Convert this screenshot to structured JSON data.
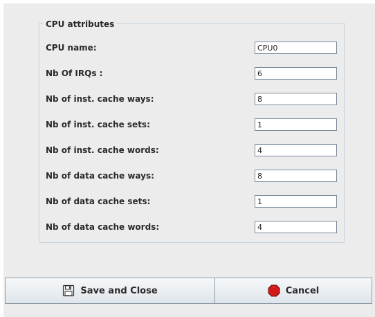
{
  "group": {
    "title": "CPU attributes"
  },
  "fields": [
    {
      "label": "CPU name:",
      "value": "CPU0"
    },
    {
      "label": "Nb Of IRQs :",
      "value": "6"
    },
    {
      "label": "Nb of inst. cache ways:",
      "value": "8"
    },
    {
      "label": "Nb of inst. cache sets:",
      "value": "1"
    },
    {
      "label": "Nb of inst. cache words:",
      "value": "4"
    },
    {
      "label": "Nb of data cache ways:",
      "value": "8"
    },
    {
      "label": "Nb of data cache sets:",
      "value": "1"
    },
    {
      "label": "Nb of data cache words:",
      "value": "4"
    }
  ],
  "buttons": {
    "save_label": "Save and Close",
    "save_icon": "floppy-disk-icon",
    "cancel_label": "Cancel",
    "cancel_icon": "red-stop-icon"
  },
  "colors": {
    "cancel_icon": "#d11a1a"
  }
}
